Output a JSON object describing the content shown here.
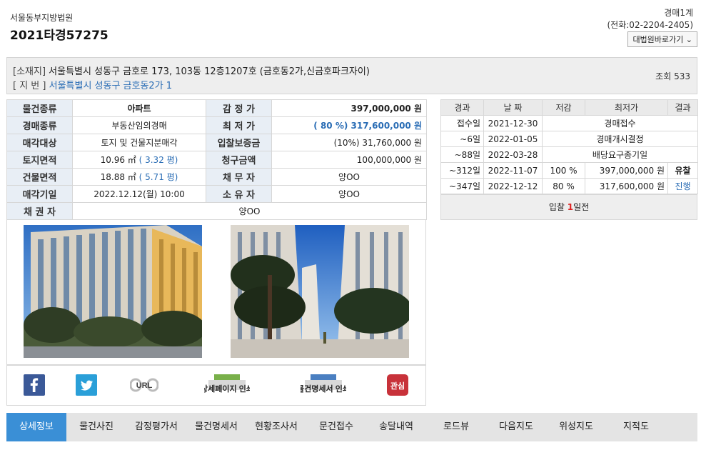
{
  "header": {
    "court": "서울동부지방법원",
    "case_no": "2021타경57275",
    "dept": "경매1계",
    "phone": "(전화:02-2204-2405)",
    "court_btn": "대법원바로가기 ⌄"
  },
  "address": {
    "loc_label": "[소재지]",
    "loc_value": "서울특별시 성동구 금호로 173, 103동 12층1207호 (금호동2가,신금호파크자이)",
    "lot_label": "[ 지 번 ]",
    "lot_value": "서울특별시 성동구 금호동2가 1",
    "views_label": "조회",
    "views_value": "533"
  },
  "info": {
    "rows": [
      {
        "k1": "물건종류",
        "v1": "아파트",
        "k2": "감 정 가",
        "v2": "397,000,000 원"
      },
      {
        "k1": "경매종류",
        "v1": "부동산임의경매",
        "k2": "최 저 가",
        "v2": "( 80 %) 317,600,000 원"
      },
      {
        "k1": "매각대상",
        "v1": "토지 및 건물지분매각",
        "k2": "입찰보증금",
        "v2": "(10%) 31,760,000 원"
      },
      {
        "k1": "토지면적",
        "v1": "10.96 ㎡",
        "v1b": "( 3.32 평)",
        "k2": "청구금액",
        "v2": "100,000,000 원"
      },
      {
        "k1": "건물면적",
        "v1": "18.88 ㎡",
        "v1b": "( 5.71 평)",
        "k2": "채 무 자",
        "v2": "양OO"
      },
      {
        "k1": "매각기일",
        "v1": "2022.12.12(월) 10:00",
        "k2": "소 유 자",
        "v2": "양OO"
      }
    ],
    "creditor_label": "채 권 자",
    "creditor_value": "양OO"
  },
  "share": {
    "url_label": "URL",
    "print_detail": "상세페이지 인쇄",
    "print_spec": "물건명세서 인쇄",
    "interest": "관심"
  },
  "history": {
    "headers": [
      "경과",
      "날 짜",
      "저감",
      "최저가",
      "결과"
    ],
    "rows": [
      {
        "elapsed": "접수일",
        "date": "2021-12-30",
        "desc": "경매접수"
      },
      {
        "elapsed": "~6일",
        "date": "2022-01-05",
        "desc": "경매개시결정"
      },
      {
        "elapsed": "~88일",
        "date": "2022-03-28",
        "desc": "배당요구종기일"
      },
      {
        "elapsed": "~312일",
        "date": "2022-11-07",
        "rate": "100 %",
        "price": "397,000,000 원",
        "result": "유찰"
      },
      {
        "elapsed": "~347일",
        "date": "2022-12-12",
        "rate": "80 %",
        "price": "317,600,000 원",
        "result": "진행"
      }
    ],
    "footer_pre": "입찰",
    "footer_num": "1",
    "footer_post": "일전"
  },
  "tabs": [
    "상세정보",
    "물건사진",
    "감정평가서",
    "물건명세서",
    "현황조사서",
    "문건접수",
    "송달내역",
    "로드뷰",
    "다음지도",
    "위성지도",
    "지적도"
  ],
  "colors": {
    "accent": "#3a8fd6",
    "link": "#2a6db5",
    "red": "#dd2222"
  }
}
